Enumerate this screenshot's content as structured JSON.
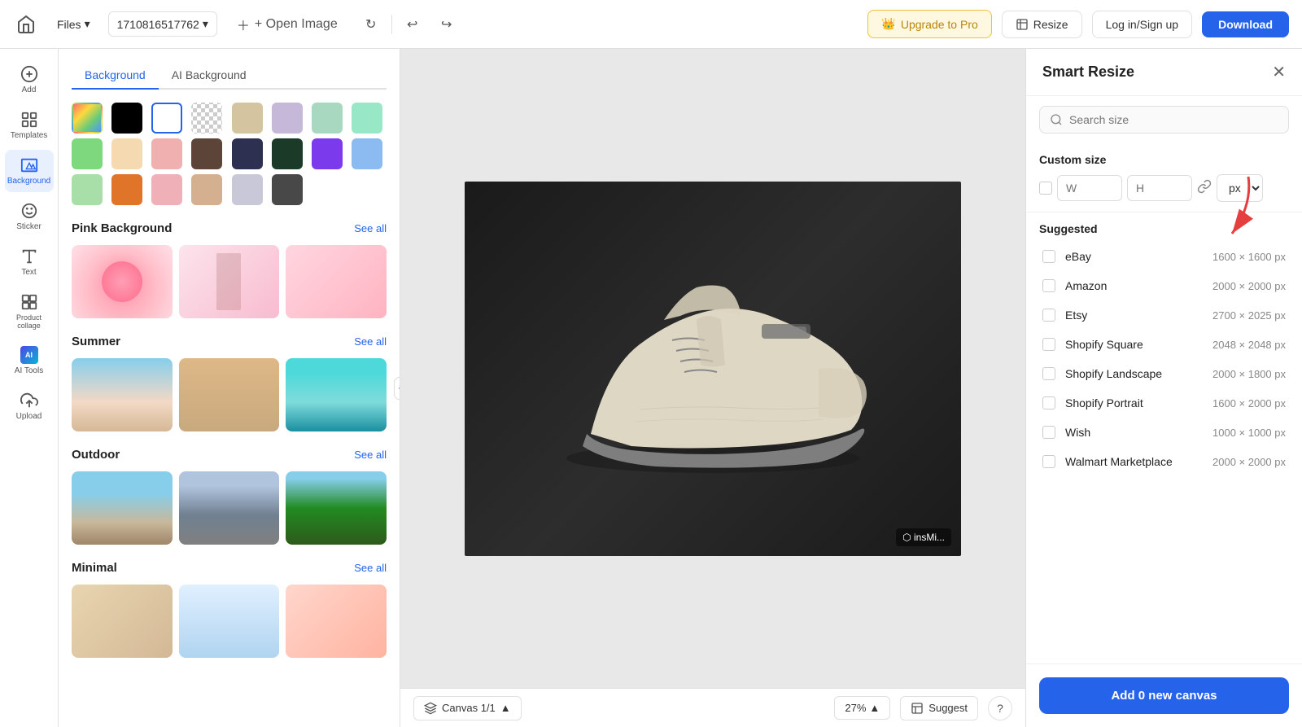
{
  "topbar": {
    "home_icon": "🏠",
    "files_label": "Files",
    "filename": "1710816517762",
    "open_image_label": "+ Open Image",
    "upgrade_label": "Upgrade to Pro",
    "resize_label": "Resize",
    "login_label": "Log in/Sign up",
    "download_label": "Download"
  },
  "left_panel": {
    "bg_tab_background": "Background",
    "bg_tab_ai": "AI Background",
    "section_pink": "Pink Background",
    "section_summer": "Summer",
    "section_outdoor": "Outdoor",
    "section_minimal": "Minimal",
    "see_all_label": "See all"
  },
  "icon_rail": {
    "add_label": "Add",
    "templates_label": "Templates",
    "background_label": "Background",
    "sticker_label": "Sticker",
    "text_label": "Text",
    "product_collage_label": "Product collage",
    "ai_tools_label": "AI Tools",
    "upload_label": "Upload"
  },
  "canvas": {
    "name": "Canvas 1/1",
    "zoom": "27%",
    "watermark": "⬡ insMi..."
  },
  "smart_resize": {
    "title": "Smart Resize",
    "search_placeholder": "Search size",
    "custom_size_label": "Custom size",
    "w_placeholder": "W",
    "h_placeholder": "H",
    "px_option": "px",
    "suggested_label": "Suggested",
    "items": [
      {
        "name": "eBay",
        "size": "1600 × 1600 px"
      },
      {
        "name": "Amazon",
        "size": "2000 × 2000 px"
      },
      {
        "name": "Etsy",
        "size": "2700 × 2025 px"
      },
      {
        "name": "Shopify Square",
        "size": "2048 × 2048 px"
      },
      {
        "name": "Shopify Landscape",
        "size": "2000 × 1800 px"
      },
      {
        "name": "Shopify Portrait",
        "size": "1600 × 2000 px"
      },
      {
        "name": "Wish",
        "size": "1000 × 1000 px"
      },
      {
        "name": "Walmart Marketplace",
        "size": "2000 × 2000 px"
      }
    ],
    "add_button": "Add 0 new canvas"
  },
  "bottom_bar": {
    "suggest_label": "Suggest",
    "help_label": "?"
  },
  "colors": [
    {
      "type": "gradient-rainbow",
      "hex": ""
    },
    {
      "type": "solid",
      "hex": "#000000"
    },
    {
      "type": "solid",
      "hex": "#ffffff",
      "selected": true
    },
    {
      "type": "checker",
      "hex": ""
    },
    {
      "type": "solid",
      "hex": "#d4c4a0"
    },
    {
      "type": "solid",
      "hex": "#c5b8d8"
    },
    {
      "type": "solid",
      "hex": "#a8d8c0"
    },
    {
      "type": "solid",
      "hex": "#98e8c8"
    },
    {
      "type": "solid",
      "hex": "#7ed87e"
    },
    {
      "type": "solid",
      "hex": "#f5d9b0"
    },
    {
      "type": "solid",
      "hex": "#f0b0b0"
    },
    {
      "type": "solid",
      "hex": "#5c4438"
    },
    {
      "type": "solid",
      "hex": "#2d3050"
    },
    {
      "type": "solid",
      "hex": "#1c3a28"
    },
    {
      "type": "solid",
      "hex": "#7c3aed"
    },
    {
      "type": "solid",
      "hex": "#8bbbf0"
    },
    {
      "type": "solid",
      "hex": "#a8dfa8"
    },
    {
      "type": "solid",
      "hex": "#e07428"
    },
    {
      "type": "solid",
      "hex": "#f0b0b8"
    },
    {
      "type": "solid",
      "hex": "#d4b090"
    },
    {
      "type": "solid",
      "hex": "#c8c8d8"
    },
    {
      "type": "solid",
      "hex": "#484848"
    }
  ]
}
